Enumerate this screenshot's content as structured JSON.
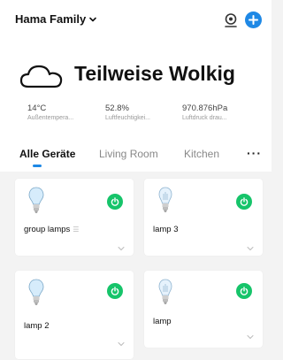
{
  "header": {
    "home_name": "Hama Family",
    "icons": [
      "chevron-down-icon",
      "scene-icon",
      "add-icon"
    ],
    "accent_color": "#1e88e5"
  },
  "weather": {
    "condition": "Teilweise Wolkig",
    "icon": "cloud-icon",
    "stats": [
      {
        "value": "14°C",
        "label": "Außentempera..."
      },
      {
        "value": "52.8%",
        "label": "Luftfeuchtigkei..."
      },
      {
        "value": "970.876hPa",
        "label": "Luftdruck drau..."
      }
    ]
  },
  "tabs": {
    "items": [
      "Alle Geräte",
      "Living Room",
      "Kitchen"
    ],
    "active": "Alle Geräte",
    "more": "···"
  },
  "devices": [
    {
      "name": "group lamps",
      "icon": "bulb-icon",
      "group_icon": "list-icon",
      "power_color": "#16c46a"
    },
    {
      "name": "lamp 3",
      "icon": "bulb-icon",
      "power_color": "#16c46a"
    },
    {
      "name": "lamp 2",
      "icon": "bulb-icon",
      "power_color": "#16c46a"
    },
    {
      "name": "lamp",
      "icon": "bulb-icon",
      "power_color": "#16c46a"
    }
  ]
}
